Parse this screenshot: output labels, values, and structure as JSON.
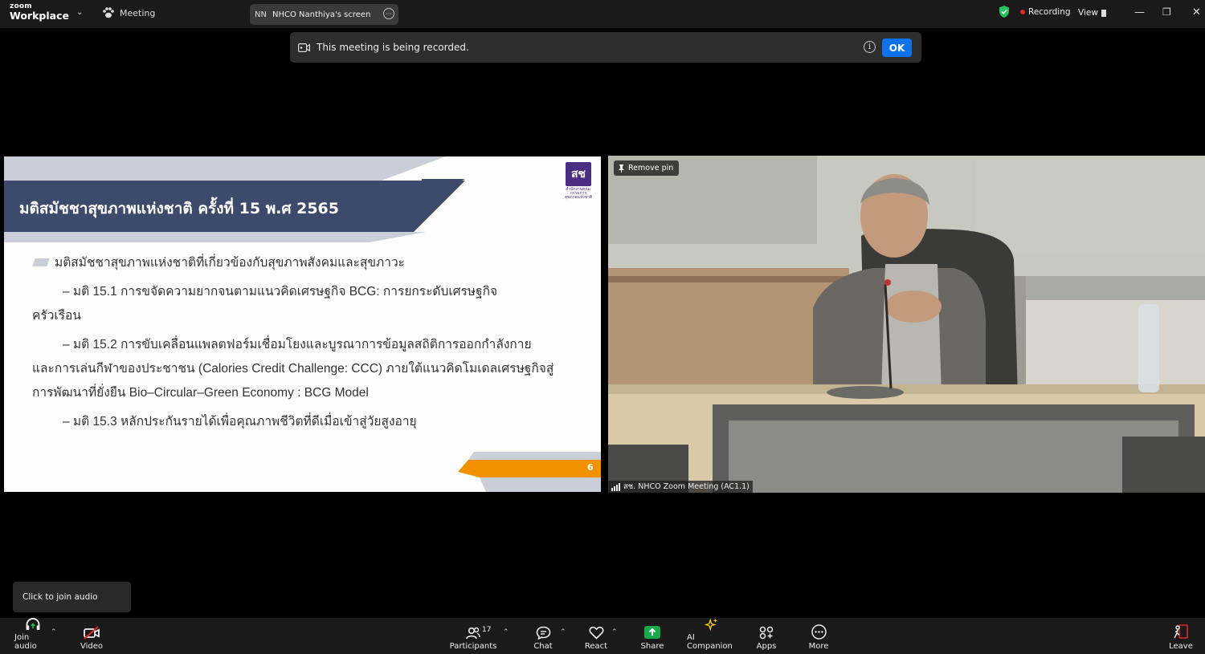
{
  "titlebar": {
    "logo_line1": "zoom",
    "logo_line2": "Workplace",
    "meeting_label": "Meeting",
    "screen_initials": "NN",
    "screen_label": "NHCO Nanthiya's screen",
    "recording_label": "Recording",
    "view_label": "View"
  },
  "notification": {
    "text": "This meeting is being recorded.",
    "ok_label": "OK"
  },
  "slide": {
    "title": "มติสมัชชาสุขภาพแห่งชาติ ครั้งที่ 15 พ.ศ 2565",
    "logo_text": "สช",
    "logo_sub": "สำนักงานคณะกรรมการสุขภาพแห่งชาติ",
    "bullet": "มติสมัชชาสุขภาพแห่งชาติที่เกี่ยวข้องกับสุขภาพสังคมและสุขภาวะ",
    "item1_line1": "– มติ 15.1 การขจัดความยากจนตามแนวคิดเศรษฐกิจ BCG: การยกระดับเศรษฐกิจ",
    "item1_line2": "ครัวเรือน",
    "item2_line1": "– มติ 15.2 การขับเคลื่อนแพลตฟอร์มเชื่อมโยงและบูรณาการข้อมูลสถิติการออกกำลังกาย",
    "item2_line2": "และการเล่นกีฬาของประชาชน (Calories Credit Challenge: CCC) ภายใต้แนวคิดโมเดลเศรษฐกิจสู่",
    "item2_line3": "การพัฒนาที่ยั่งยืน Bio–Circular–Green Economy : BCG Model",
    "item3_line1": "– มติ 15.3 หลักประกันรายได้เพื่อคุณภาพชีวิตที่ดีเมื่อเข้าสู่วัยสูงอายุ",
    "page_number": "6"
  },
  "video": {
    "remove_pin_label": "Remove pin",
    "participant_name": "สช. NHCO Zoom Meeting (AC1.1)"
  },
  "tooltip": "Click to join audio",
  "toolbar": {
    "join_audio": "Join audio",
    "video": "Video",
    "participants": "Participants",
    "participants_count": "17",
    "chat": "Chat",
    "react": "React",
    "share": "Share",
    "ai_companion": "AI Companion",
    "apps": "Apps",
    "more": "More",
    "leave": "Leave"
  },
  "colors": {
    "slide_navy": "#3e4a6b",
    "slide_band": "#c9ced8",
    "slide_orange": "#f39200",
    "share_green": "#19a84a",
    "ok_blue": "#0e72ed",
    "shield_green": "#23c45e",
    "rec_red": "#e02828",
    "leave_red": "#e02828"
  }
}
